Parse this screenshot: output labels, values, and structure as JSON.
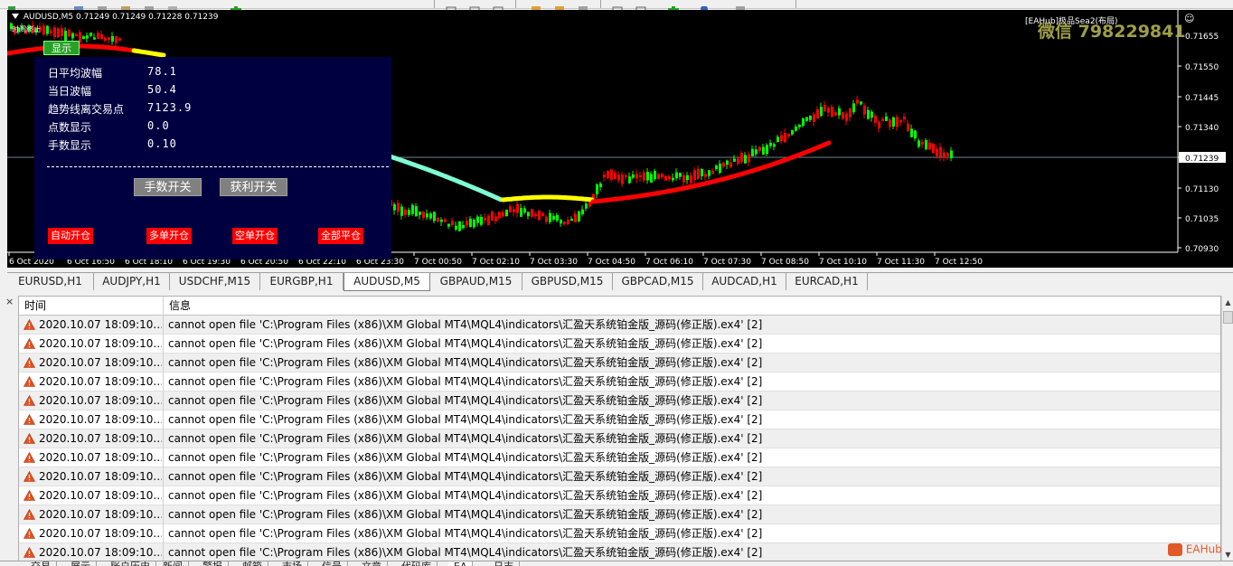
{
  "chart": {
    "symbol_line": "AUDUSD,M5  0.71249 0.71249 0.71228 0.71239",
    "status_small": "时间终止",
    "ea_label": "[EAHub]极品Sea2(布局)",
    "watermark": "微信 798229841",
    "price_labels": [
      "0.71655",
      "0.71550",
      "0.71445",
      "0.71340",
      "0.71239",
      "0.71130",
      "0.71035",
      "0.70930"
    ],
    "current_price": "0.71239",
    "time_labels": [
      "6 Oct 2020",
      "6 Oct 16:50",
      "6 Oct 18:10",
      "6 Oct 19:30",
      "6 Oct 20:50",
      "6 Oct 22:10",
      "6 Oct 23:30",
      "7 Oct 00:50",
      "7 Oct 02:10",
      "7 Oct 03:30",
      "7 Oct 04:50",
      "7 Oct 06:10",
      "7 Oct 07:30",
      "7 Oct 08:50",
      "7 Oct 10:10",
      "7 Oct 11:30",
      "7 Oct 12:50"
    ],
    "colors": {
      "background": "#000000",
      "bull": "#00ff00",
      "bear": "#ff0000",
      "ma_up": "#ff0000",
      "ma_flat": "#ffff00",
      "ma_down": "#7fffd4",
      "grid": "#4a4a4a"
    }
  },
  "panel": {
    "show_button": "显示",
    "rows": [
      {
        "label": "日平均波幅",
        "value": "78.1"
      },
      {
        "label": "当日波幅",
        "value": "50.4"
      },
      {
        "label": "趋势线离交易点",
        "value": "7123.9"
      },
      {
        "label": "点数显示",
        "value": "0.0"
      },
      {
        "label": "手数显示",
        "value": "0.10"
      }
    ],
    "lot_switch": "手数开关",
    "profit_switch": "获利开关",
    "auto_open": "自动开仓",
    "buy_open": "多单开仓",
    "sell_open": "空单开仓",
    "close_all": "全部平仓"
  },
  "chart_tabs": [
    "EURUSD,H1",
    "AUDJPY,H1",
    "USDCHF,M15",
    "EURGBP,H1",
    "AUDUSD,M5",
    "GBPAUD,M15",
    "GBPUSD,M15",
    "GBPCAD,M15",
    "AUDCAD,H1",
    "EURCAD,H1"
  ],
  "active_chart_tab": "AUDUSD,M5",
  "terminal": {
    "close_glyph": "×",
    "headers": {
      "time": "时间",
      "message": "信息"
    },
    "rows": [
      {
        "time": "2020.10.07 18:09:10.…",
        "message": "cannot open file 'C:\\Program Files (x86)\\XM Global MT4\\MQL4\\indicators\\汇盈天系统铂金版_源码(修正版).ex4' [2]"
      },
      {
        "time": "2020.10.07 18:09:10.…",
        "message": "cannot open file 'C:\\Program Files (x86)\\XM Global MT4\\MQL4\\indicators\\汇盈天系统铂金版_源码(修正版).ex4' [2]"
      },
      {
        "time": "2020.10.07 18:09:10.…",
        "message": "cannot open file 'C:\\Program Files (x86)\\XM Global MT4\\MQL4\\indicators\\汇盈天系统铂金版_源码(修正版).ex4' [2]"
      },
      {
        "time": "2020.10.07 18:09:10.…",
        "message": "cannot open file 'C:\\Program Files (x86)\\XM Global MT4\\MQL4\\indicators\\汇盈天系统铂金版_源码(修正版).ex4' [2]"
      },
      {
        "time": "2020.10.07 18:09:10.…",
        "message": "cannot open file 'C:\\Program Files (x86)\\XM Global MT4\\MQL4\\indicators\\汇盈天系统铂金版_源码(修正版).ex4' [2]"
      },
      {
        "time": "2020.10.07 18:09:10.…",
        "message": "cannot open file 'C:\\Program Files (x86)\\XM Global MT4\\MQL4\\indicators\\汇盈天系统铂金版_源码(修正版).ex4' [2]"
      },
      {
        "time": "2020.10.07 18:09:10.…",
        "message": "cannot open file 'C:\\Program Files (x86)\\XM Global MT4\\MQL4\\indicators\\汇盈天系统铂金版_源码(修正版).ex4' [2]"
      },
      {
        "time": "2020.10.07 18:09:10.…",
        "message": "cannot open file 'C:\\Program Files (x86)\\XM Global MT4\\MQL4\\indicators\\汇盈天系统铂金版_源码(修正版).ex4' [2]"
      },
      {
        "time": "2020.10.07 18:09:10.…",
        "message": "cannot open file 'C:\\Program Files (x86)\\XM Global MT4\\MQL4\\indicators\\汇盈天系统铂金版_源码(修正版).ex4' [2]"
      },
      {
        "time": "2020.10.07 18:09:10.…",
        "message": "cannot open file 'C:\\Program Files (x86)\\XM Global MT4\\MQL4\\indicators\\汇盈天系统铂金版_源码(修正版).ex4' [2]"
      },
      {
        "time": "2020.10.07 18:09:10.…",
        "message": "cannot open file 'C:\\Program Files (x86)\\XM Global MT4\\MQL4\\indicators\\汇盈天系统铂金版_源码(修正版).ex4' [2]"
      },
      {
        "time": "2020.10.07 18:09:10.…",
        "message": "cannot open file 'C:\\Program Files (x86)\\XM Global MT4\\MQL4\\indicators\\汇盈天系统铂金版_源码(修正版).ex4' [2]"
      },
      {
        "time": "2020.10.07 18:09:10.…",
        "message": "cannot open file 'C:\\Program Files (x86)\\XM Global MT4\\MQL4\\indicators\\汇盈天系统铂金版_源码(修正版).ex4' [2]"
      }
    ]
  },
  "bottom_tabs": [
    "交易",
    "展示",
    "账户历史",
    "新闻",
    "警报",
    "邮箱",
    "市场",
    "信号",
    "文章",
    "代码库",
    "EA",
    "日志"
  ],
  "active_bottom_tab": "EA",
  "brand_badge": "EAHub"
}
